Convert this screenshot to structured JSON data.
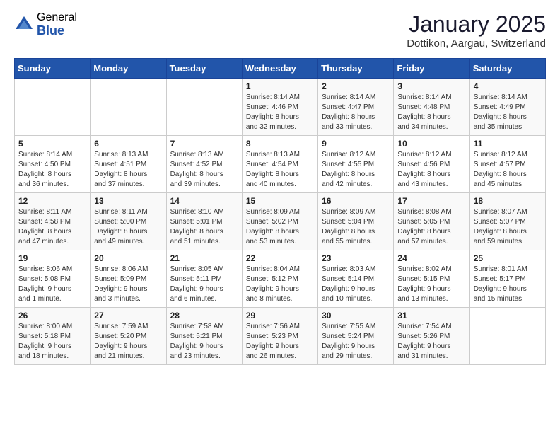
{
  "logo": {
    "general": "General",
    "blue": "Blue"
  },
  "title": "January 2025",
  "location": "Dottikon, Aargau, Switzerland",
  "weekdays": [
    "Sunday",
    "Monday",
    "Tuesday",
    "Wednesday",
    "Thursday",
    "Friday",
    "Saturday"
  ],
  "weeks": [
    [
      {
        "day": "",
        "info": ""
      },
      {
        "day": "",
        "info": ""
      },
      {
        "day": "",
        "info": ""
      },
      {
        "day": "1",
        "info": "Sunrise: 8:14 AM\nSunset: 4:46 PM\nDaylight: 8 hours\nand 32 minutes."
      },
      {
        "day": "2",
        "info": "Sunrise: 8:14 AM\nSunset: 4:47 PM\nDaylight: 8 hours\nand 33 minutes."
      },
      {
        "day": "3",
        "info": "Sunrise: 8:14 AM\nSunset: 4:48 PM\nDaylight: 8 hours\nand 34 minutes."
      },
      {
        "day": "4",
        "info": "Sunrise: 8:14 AM\nSunset: 4:49 PM\nDaylight: 8 hours\nand 35 minutes."
      }
    ],
    [
      {
        "day": "5",
        "info": "Sunrise: 8:14 AM\nSunset: 4:50 PM\nDaylight: 8 hours\nand 36 minutes."
      },
      {
        "day": "6",
        "info": "Sunrise: 8:13 AM\nSunset: 4:51 PM\nDaylight: 8 hours\nand 37 minutes."
      },
      {
        "day": "7",
        "info": "Sunrise: 8:13 AM\nSunset: 4:52 PM\nDaylight: 8 hours\nand 39 minutes."
      },
      {
        "day": "8",
        "info": "Sunrise: 8:13 AM\nSunset: 4:54 PM\nDaylight: 8 hours\nand 40 minutes."
      },
      {
        "day": "9",
        "info": "Sunrise: 8:12 AM\nSunset: 4:55 PM\nDaylight: 8 hours\nand 42 minutes."
      },
      {
        "day": "10",
        "info": "Sunrise: 8:12 AM\nSunset: 4:56 PM\nDaylight: 8 hours\nand 43 minutes."
      },
      {
        "day": "11",
        "info": "Sunrise: 8:12 AM\nSunset: 4:57 PM\nDaylight: 8 hours\nand 45 minutes."
      }
    ],
    [
      {
        "day": "12",
        "info": "Sunrise: 8:11 AM\nSunset: 4:58 PM\nDaylight: 8 hours\nand 47 minutes."
      },
      {
        "day": "13",
        "info": "Sunrise: 8:11 AM\nSunset: 5:00 PM\nDaylight: 8 hours\nand 49 minutes."
      },
      {
        "day": "14",
        "info": "Sunrise: 8:10 AM\nSunset: 5:01 PM\nDaylight: 8 hours\nand 51 minutes."
      },
      {
        "day": "15",
        "info": "Sunrise: 8:09 AM\nSunset: 5:02 PM\nDaylight: 8 hours\nand 53 minutes."
      },
      {
        "day": "16",
        "info": "Sunrise: 8:09 AM\nSunset: 5:04 PM\nDaylight: 8 hours\nand 55 minutes."
      },
      {
        "day": "17",
        "info": "Sunrise: 8:08 AM\nSunset: 5:05 PM\nDaylight: 8 hours\nand 57 minutes."
      },
      {
        "day": "18",
        "info": "Sunrise: 8:07 AM\nSunset: 5:07 PM\nDaylight: 8 hours\nand 59 minutes."
      }
    ],
    [
      {
        "day": "19",
        "info": "Sunrise: 8:06 AM\nSunset: 5:08 PM\nDaylight: 9 hours\nand 1 minute."
      },
      {
        "day": "20",
        "info": "Sunrise: 8:06 AM\nSunset: 5:09 PM\nDaylight: 9 hours\nand 3 minutes."
      },
      {
        "day": "21",
        "info": "Sunrise: 8:05 AM\nSunset: 5:11 PM\nDaylight: 9 hours\nand 6 minutes."
      },
      {
        "day": "22",
        "info": "Sunrise: 8:04 AM\nSunset: 5:12 PM\nDaylight: 9 hours\nand 8 minutes."
      },
      {
        "day": "23",
        "info": "Sunrise: 8:03 AM\nSunset: 5:14 PM\nDaylight: 9 hours\nand 10 minutes."
      },
      {
        "day": "24",
        "info": "Sunrise: 8:02 AM\nSunset: 5:15 PM\nDaylight: 9 hours\nand 13 minutes."
      },
      {
        "day": "25",
        "info": "Sunrise: 8:01 AM\nSunset: 5:17 PM\nDaylight: 9 hours\nand 15 minutes."
      }
    ],
    [
      {
        "day": "26",
        "info": "Sunrise: 8:00 AM\nSunset: 5:18 PM\nDaylight: 9 hours\nand 18 minutes."
      },
      {
        "day": "27",
        "info": "Sunrise: 7:59 AM\nSunset: 5:20 PM\nDaylight: 9 hours\nand 21 minutes."
      },
      {
        "day": "28",
        "info": "Sunrise: 7:58 AM\nSunset: 5:21 PM\nDaylight: 9 hours\nand 23 minutes."
      },
      {
        "day": "29",
        "info": "Sunrise: 7:56 AM\nSunset: 5:23 PM\nDaylight: 9 hours\nand 26 minutes."
      },
      {
        "day": "30",
        "info": "Sunrise: 7:55 AM\nSunset: 5:24 PM\nDaylight: 9 hours\nand 29 minutes."
      },
      {
        "day": "31",
        "info": "Sunrise: 7:54 AM\nSunset: 5:26 PM\nDaylight: 9 hours\nand 31 minutes."
      },
      {
        "day": "",
        "info": ""
      }
    ]
  ]
}
